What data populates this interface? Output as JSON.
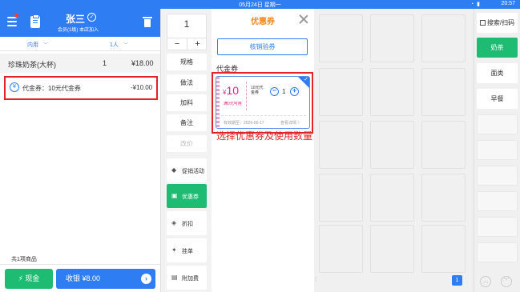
{
  "status_bar": {
    "date": "05月24日 星期一",
    "time": "20:57"
  },
  "customer": {
    "name": "张三",
    "subtitle": "会员(1级) 本店加入"
  },
  "order_options": {
    "dine_type": "内用",
    "people": "1人"
  },
  "order_item": {
    "name": "珍珠奶茶(大杯)",
    "qty": "1",
    "price": "¥18.00"
  },
  "coupon_line": {
    "label": "代金券：10元代金券",
    "amount": "-¥10.00"
  },
  "total_count": "共1项商品",
  "footer": {
    "cash_label": "现金",
    "pay_label": "收银 ¥8.00"
  },
  "quantity": {
    "value": "1",
    "minus": "−",
    "plus": "+"
  },
  "ops": [
    "规格",
    "做法",
    "加料",
    "备注",
    "改价"
  ],
  "ops2": [
    {
      "label": "促销活动",
      "icon": "tag-icon"
    },
    {
      "label": "优惠券",
      "icon": "coupon-icon"
    },
    {
      "label": "折扣",
      "icon": "discount-icon"
    },
    {
      "label": "挂单",
      "icon": "pin-icon"
    },
    {
      "label": "附加费",
      "icon": "receipt-icon"
    }
  ],
  "panel": {
    "title": "优惠券",
    "verify_label": "核销验券",
    "section_label": "代金券"
  },
  "coupon_card": {
    "currency": "¥",
    "value": "10",
    "condition": "满0元可用",
    "kind": "10元代金券",
    "qty": "1",
    "expiry": "有效期至：2026-06-17",
    "detail": "查看详情 〉"
  },
  "instruction": "选择优惠券及使用数量",
  "page_number": "1",
  "categories": [
    "搜索/扫码",
    "奶茶",
    "面类",
    "早餐"
  ],
  "colors": {
    "brand_blue": "#2f7df3",
    "green": "#1ebc73",
    "highlight_red": "#e0242a",
    "coupon_pink": "#e0267b"
  }
}
